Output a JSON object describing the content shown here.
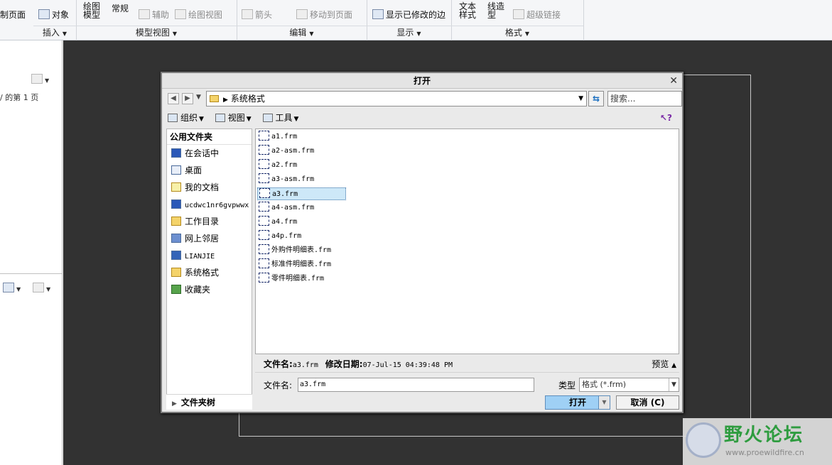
{
  "ribbon": {
    "items": {
      "custom_page": "制页面",
      "object": "对象",
      "draw_model": "绘图\n模型",
      "general": "常规",
      "aux": "辅助",
      "drawing_view": "绘图视图",
      "arrow": "箭头",
      "move_to_page": "移动到页面",
      "show_modified_edges": "显示已修改的边",
      "text_style": "文本\n样式",
      "line_style": "线造\n型",
      "hyperlink": "超级链接"
    },
    "groups": {
      "insert": "插入",
      "model_views": "模型视图",
      "edit": "编辑",
      "display": "显示",
      "format": "格式"
    }
  },
  "left_panel": {
    "page_text": "/ 的第 1 页"
  },
  "dialog": {
    "title": "打开",
    "path": "系统格式",
    "search_placeholder": "搜索...",
    "toolbar": {
      "organize": "组织",
      "views": "视图",
      "tools": "工具"
    },
    "places_header": "公用文件夹",
    "places": [
      {
        "label": "在会话中",
        "icon": "session-icon"
      },
      {
        "label": "桌面",
        "icon": "desktop-icon"
      },
      {
        "label": "我的文档",
        "icon": "my-documents-icon"
      },
      {
        "label": "ucdwc1nr6gvpwwx",
        "icon": "computer-icon"
      },
      {
        "label": "工作目录",
        "icon": "working-directory-icon"
      },
      {
        "label": "网上邻居",
        "icon": "network-icon"
      },
      {
        "label": "LIANJIE",
        "icon": "library-icon"
      },
      {
        "label": "系统格式",
        "icon": "folder-icon"
      },
      {
        "label": "收藏夹",
        "icon": "favorites-icon"
      }
    ],
    "folder_tree": "文件夹树",
    "files": [
      "a1.frm",
      "a2-asm.frm",
      "a2.frm",
      "a3-asm.frm",
      "a3.frm",
      "a4-asm.frm",
      "a4.frm",
      "a4p.frm",
      "外购件明细表.frm",
      "标准件明细表.frm",
      "零件明细表.frm"
    ],
    "selected_file": "a3.frm",
    "info": {
      "filename_label": "文件名:",
      "filename": "a3.frm",
      "modified_label": "修改日期:",
      "modified": "07-Jul-15 04:39:48 PM",
      "preview": "预览"
    },
    "filename_field_label": "文件名:",
    "filename_field_value": "a3.frm",
    "type_label": "类型",
    "type_value": "格式 (*.frm)",
    "open_button": "打开",
    "cancel_button": "取消 (C)"
  },
  "watermark": {
    "title": "野火论坛",
    "url": "www.proewildfire.cn"
  }
}
